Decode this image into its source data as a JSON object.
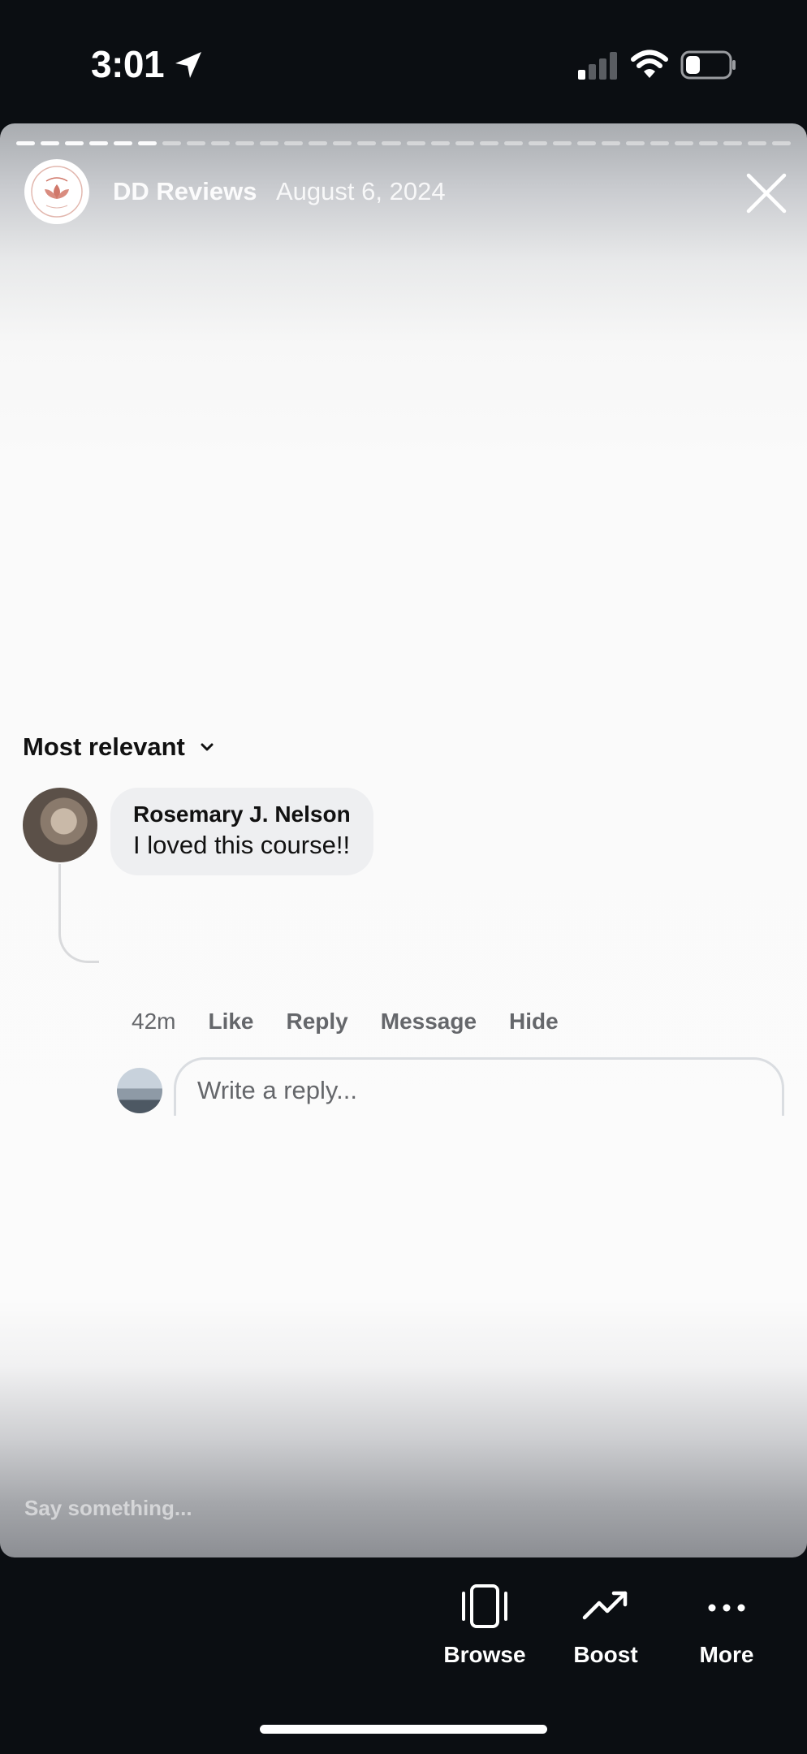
{
  "status_bar": {
    "time": "3:01",
    "icons": [
      "location-arrow-icon",
      "cellular-signal-icon",
      "wifi-icon",
      "battery-icon"
    ]
  },
  "story": {
    "page_name": "DD Reviews",
    "date": "August 6, 2024",
    "progress": {
      "segments": 32,
      "completed": 6
    }
  },
  "comments": {
    "sort_label": "Most relevant",
    "items": [
      {
        "author": "Rosemary J. Nelson",
        "text": "I loved this course!!",
        "time": "42m",
        "actions": {
          "like": "Like",
          "reply": "Reply",
          "message": "Message",
          "hide": "Hide"
        }
      }
    ],
    "reply_placeholder": "Write a reply..."
  },
  "story_input": {
    "placeholder": "Say something..."
  },
  "toolbar": {
    "browse": "Browse",
    "boost": "Boost",
    "more": "More"
  },
  "colors": {
    "background": "#0b0e12",
    "bubble": "#eeeff1",
    "muted_text": "#65676b",
    "logo_accent": "#d0786a"
  }
}
